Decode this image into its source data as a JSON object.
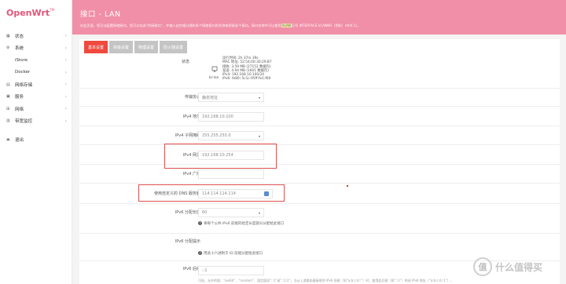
{
  "app": {
    "logo": "OpenWrt",
    "logo_sup": "TM"
  },
  "sidebar": {
    "items": [
      {
        "label": "状态",
        "icon": "dashboard-icon"
      },
      {
        "label": "系统",
        "icon": "gear-icon"
      },
      {
        "label": "iStore",
        "icon": ""
      },
      {
        "label": "Docker",
        "icon": ""
      },
      {
        "label": "网络存储",
        "icon": "storage-icon"
      },
      {
        "label": "服务",
        "icon": "services-icon"
      },
      {
        "label": "网络",
        "icon": "network-icon"
      },
      {
        "label": "带宽监控",
        "icon": "bandwidth-icon"
      }
    ],
    "logout": "退出"
  },
  "header": {
    "title": "接口 - LAN",
    "desc": "在此页面，您可以配置网络接口。您可以勾选“桥接接口”，并输入由空格分隔的多个网络接口的名称来桥接多个接口。接口名称中可以使用",
    "desc_highlight": "VLAN",
    "desc_tail": "记号 INTERFACE.VLANNR（例如：eth0.1）。"
  },
  "tabs": [
    "基本设置",
    "高级设置",
    "物理设置",
    "防火墙设置"
  ],
  "status": {
    "label": "状态",
    "iface": "br-lan",
    "lines": [
      "运行时间: 2h 37m 39s",
      "MAC 地址: 52:54:00:30:29:B7",
      "接收: 3.59 MB (27152 数据包)",
      "发送: 4.94 MB (1601 数据包)",
      "IPv4: 192.168.10.100/24",
      "IPv6: fe80::5c1c:95ff:fe1:f60"
    ]
  },
  "form": {
    "protocol": {
      "label": "传输协议",
      "value": "静态地址"
    },
    "ipv4_addr": {
      "label": "IPv4 地址",
      "value": "192.168.10.100"
    },
    "netmask": {
      "label": "IPv4 子网掩码",
      "value": "255.255.255.0"
    },
    "gateway": {
      "label": "IPv4 网关",
      "value": "192.168.10.254"
    },
    "broadcast": {
      "label": "IPv4 广播",
      "value": ""
    },
    "dns": {
      "label": "使用自定义的 DNS 服务器",
      "value": "114.114.114.114"
    },
    "ipv6_len": {
      "label": "IPv6 分配长度",
      "value": "60",
      "hint": "将每个公共 IPv6 前缀的给定长度部分分配给此接口"
    },
    "ipv6_hint": {
      "label": "IPv6 分配提示",
      "value": "",
      "hint": "用此十六进制子 ID 前缀分配给此接口"
    },
    "ipv6_suffix": {
      "label": "IPv6 后缀",
      "value": "::1"
    }
  },
  "footer": "可选，允许的值：“eui64”、“random”、固定值如“::1”或“::1:2”。当从上游路由器接收到 IPv6 前缀（如“a:b:c:d::”）时，使用此后缀（如“::1”）构成 IPv6 地址（“a:b:c:d::1”）。",
  "watermark": {
    "logo_char": "值",
    "text": "什么值得买"
  }
}
